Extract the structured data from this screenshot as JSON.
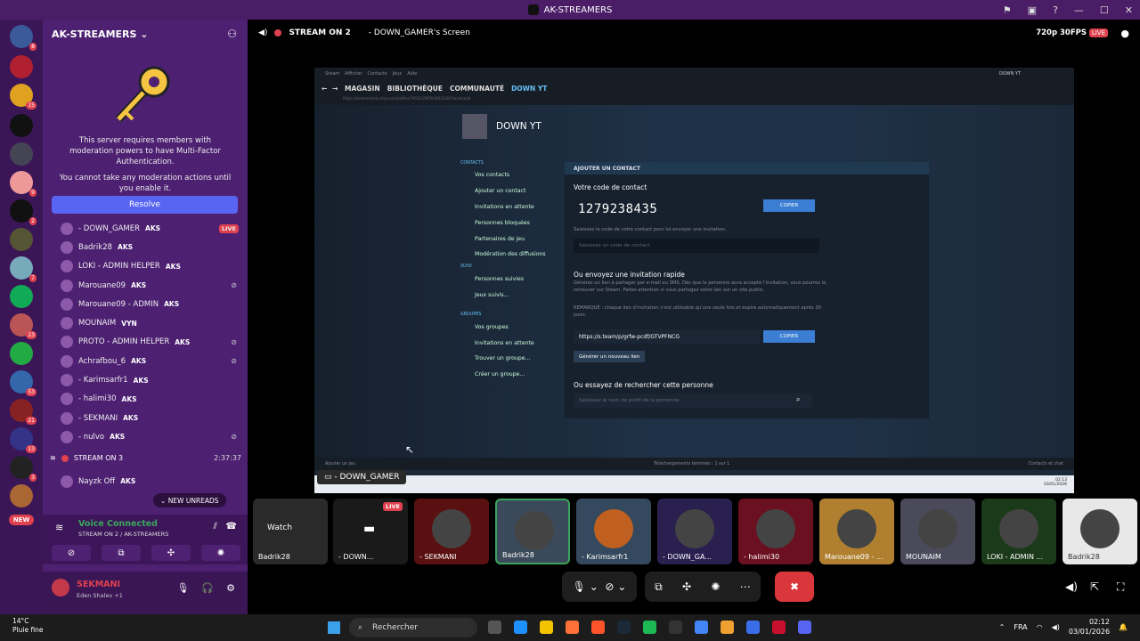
{
  "window": {
    "title": "AK-STREAMERS"
  },
  "rail": {
    "badges": [
      "8",
      "",
      "15",
      "",
      "",
      "9",
      "2",
      "",
      "7",
      "",
      "23",
      "",
      "53",
      "21",
      "13",
      "3",
      ""
    ],
    "new_label": "NEW"
  },
  "server": {
    "name": "AK-STREAMERS",
    "mfa_text1": "This server requires members with moderation powers to have Multi-Factor Authentication.",
    "mfa_text2": "You cannot take any moderation actions until you enable it.",
    "resolve_label": "Resolve"
  },
  "members": [
    {
      "name": "- DOWN_GAMER",
      "tag": "AKS",
      "live": "LIVE"
    },
    {
      "name": "Badrik28",
      "tag": "AKS"
    },
    {
      "name": "LOKI - ADMIN HELPER",
      "tag": "AKS"
    },
    {
      "name": "Marouane09",
      "tag": "AKS"
    },
    {
      "name": "Marouane09 - ADMIN",
      "tag": "AKS"
    },
    {
      "name": "MOUNAIM",
      "tag": "VYN"
    },
    {
      "name": "PROTO - ADMIN HELPER",
      "tag": "AKS"
    },
    {
      "name": "Achrafbou_6",
      "tag": "AKS"
    },
    {
      "name": "- Karimsarfr1",
      "tag": "AKS"
    },
    {
      "name": "- halimi30",
      "tag": "AKS"
    },
    {
      "name": "- SEKMANI",
      "tag": "AKS"
    },
    {
      "name": "- nulvo",
      "tag": "AKS"
    }
  ],
  "stream3": {
    "label": "STREAM ON 3",
    "time": "2:37:37"
  },
  "nayzk": {
    "name": "Nayzk Off",
    "tag": "AKS"
  },
  "new_unreads": "NEW UNREADS",
  "voice": {
    "title": "Voice Connected",
    "sub": "STREAM ON 2 / AK-STREAMERS"
  },
  "user": {
    "name": "SEKMANI",
    "status": "Eden Shalev +1"
  },
  "stage": {
    "channel": "STREAM ON 2",
    "screen": "- DOWN_GAMER's Screen",
    "quality": "720p 30FPS",
    "live": "LIVE"
  },
  "steam": {
    "top_menu": [
      "Steam",
      "Afficher",
      "Contacts",
      "Jeux",
      "Aide"
    ],
    "nav": [
      "MAGASIN",
      "BIBLIOTHÈQUE",
      "COMMUNAUTÉ",
      "DOWN YT"
    ],
    "user": "DOWN YT",
    "account": "DOWN YT",
    "url": "https://steamcommunity.com/profiles/76561199504491016/friends/add",
    "menu": [
      {
        "hd": "CONTACTS"
      },
      {
        "t": "Vos contacts"
      },
      {
        "t": "Ajouter un contact"
      },
      {
        "t": "Invitations en attente"
      },
      {
        "t": "Personnes bloquées"
      },
      {
        "t": "Partenaires de jeu"
      },
      {
        "t": "Modération des diffusions"
      },
      {
        "hd": "SUIVI"
      },
      {
        "t": "Personnes suivies"
      },
      {
        "t": "Jeux suivis..."
      },
      {
        "hd": "GROUPES"
      },
      {
        "t": "Vos groupes"
      },
      {
        "t": "Invitations en attente"
      },
      {
        "t": "Trouver un groupe..."
      },
      {
        "t": "Créer un groupe..."
      }
    ],
    "panel_title": "AJOUTER UN CONTACT",
    "code_label": "Votre code de contact",
    "code": "1279238435",
    "copy": "COPIER",
    "code_help": "Saisissez le code de votre contact pour lui envoyer une invitation.",
    "code_placeholder": "Saisissez un code de contact",
    "quick_title": "Ou envoyez une invitation rapide",
    "quick_help": "Générez un lien à partager par e-mail ou SMS. Dès que la personne aura accepté l'invitation, vous pourrez la retrouver sur Steam. Faites attention si vous partagez votre lien sur un site public.",
    "quick_note": "REMARQUE : chaque lien d'invitation n'est utilisable qu'une seule fois et expire automatiquement après 30 jours.",
    "link": "https://s.team/p/grfw-pcdf/GTVPFNCG",
    "generate": "Générer un nouveau lien",
    "search_title": "Ou essayez de rechercher cette personne",
    "search_placeholder": "Saisissez le nom de profil de la personne",
    "bottom_left": "Ajouter un jeu",
    "bottom_mid": "Téléchargements terminés : 1 sur 1",
    "bottom_right": "Contacts et chat",
    "clock_time": "02:13",
    "clock_date": "03/01/2026"
  },
  "presenter": "- DOWN_GAMER",
  "tiles": [
    {
      "name": "Badrik28",
      "watch": "Watch"
    },
    {
      "name": "- DOWN...",
      "live": "LIVE"
    },
    {
      "name": "- SEKMANI"
    },
    {
      "name": "Badrik28"
    },
    {
      "name": "- Karimsarfr1"
    },
    {
      "name": "- DOWN_GA..."
    },
    {
      "name": "- halimi30"
    },
    {
      "name": "Marouane09 - ..."
    },
    {
      "name": "MOUNAIM"
    },
    {
      "name": "LOKI - ADMIN ..."
    },
    {
      "name": "Badrik28"
    }
  ],
  "taskbar": {
    "temp": "14°C",
    "weather": "Pluie fine",
    "search": "Rechercher",
    "lang": "FRA",
    "time": "02:12",
    "date": "03/01/2026"
  }
}
